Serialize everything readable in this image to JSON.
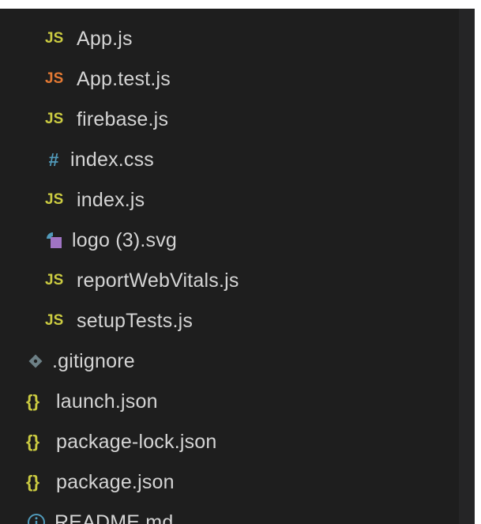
{
  "explorer": {
    "files": [
      {
        "label": "App.js",
        "icon": "js-icon",
        "icon_text": "JS",
        "color": "#cbcb41"
      },
      {
        "label": "App.test.js",
        "icon": "js-test-icon",
        "icon_text": "JS",
        "color": "#e37933"
      },
      {
        "label": "firebase.js",
        "icon": "js-icon",
        "icon_text": "JS",
        "color": "#cbcb41"
      },
      {
        "label": "index.css",
        "icon": "css-hash-icon",
        "icon_text": "#",
        "color": "#519aba"
      },
      {
        "label": "index.js",
        "icon": "js-icon",
        "icon_text": "JS",
        "color": "#cbcb41"
      },
      {
        "label": "logo (3).svg",
        "icon": "svg-image-icon",
        "color": "#a074c4"
      },
      {
        "label": "reportWebVitals.js",
        "icon": "js-icon",
        "icon_text": "JS",
        "color": "#cbcb41"
      },
      {
        "label": "setupTests.js",
        "icon": "js-icon",
        "icon_text": "JS",
        "color": "#cbcb41"
      },
      {
        "label": ".gitignore",
        "icon": "git-diamond-icon",
        "color": "#6d8086"
      },
      {
        "label": "launch.json",
        "icon": "json-braces-icon",
        "icon_text": "{}",
        "color": "#cbcb41"
      },
      {
        "label": "package-lock.json",
        "icon": "json-braces-icon",
        "icon_text": "{}",
        "color": "#cbcb41"
      },
      {
        "label": "package.json",
        "icon": "json-braces-icon",
        "icon_text": "{}",
        "color": "#cbcb41"
      },
      {
        "label": "README.md",
        "icon": "info-circle-icon",
        "color": "#519aba"
      }
    ]
  }
}
